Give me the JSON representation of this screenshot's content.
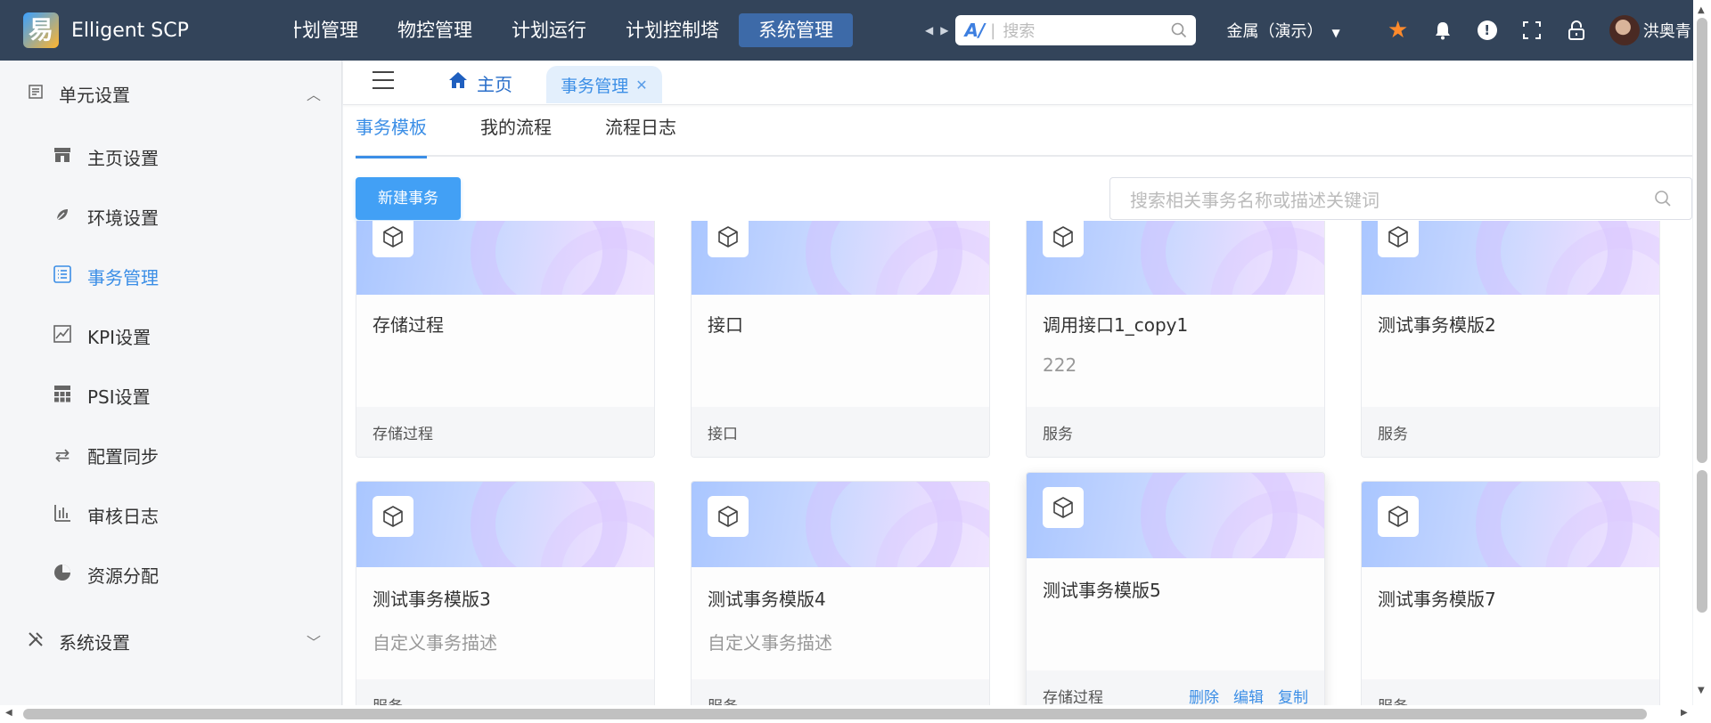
{
  "app": {
    "brand": "Elligent SCP"
  },
  "topnav": {
    "items": [
      {
        "label": "计划管理",
        "partial_label": "计划管理"
      },
      {
        "label": "物控管理"
      },
      {
        "label": "计划运行"
      },
      {
        "label": "计划控制塔"
      },
      {
        "label": "系统管理"
      }
    ],
    "search_placeholder": "搜索",
    "org": "金属（演示）",
    "user": "洪奥青"
  },
  "sidebar": {
    "unit_group": "单元设置",
    "items": [
      {
        "label": "主页设置"
      },
      {
        "label": "环境设置"
      },
      {
        "label": "事务管理"
      },
      {
        "label": "KPI设置"
      },
      {
        "label": "PSI设置"
      },
      {
        "label": "配置同步"
      },
      {
        "label": "审核日志"
      },
      {
        "label": "资源分配"
      }
    ],
    "system_group": "系统设置"
  },
  "tabs": {
    "home": "主页",
    "active": "事务管理"
  },
  "subtabs": [
    "事务模板",
    "我的流程",
    "流程日志"
  ],
  "toolbar": {
    "new_button": "新建事务",
    "search_placeholder": "搜索相关事务名称或描述关键词"
  },
  "cards": [
    {
      "title": "存储过程",
      "desc": "",
      "type": "存储过程"
    },
    {
      "title": "接口",
      "desc": "",
      "type": "接口"
    },
    {
      "title": "调用接口1_copy1",
      "desc": "222",
      "type": "服务"
    },
    {
      "title": "测试事务模版2",
      "desc": "",
      "type": "服务"
    },
    {
      "title": "测试事务模版3",
      "desc": "自定义事务描述",
      "type": "服务"
    },
    {
      "title": "测试事务模版4",
      "desc": "自定义事务描述",
      "type": "服务"
    },
    {
      "title": "测试事务模版5",
      "desc": "",
      "type": "存储过程",
      "actions": [
        "删除",
        "编辑",
        "复制"
      ]
    },
    {
      "title": "测试事务模版7",
      "desc": "",
      "type": "服务"
    }
  ]
}
